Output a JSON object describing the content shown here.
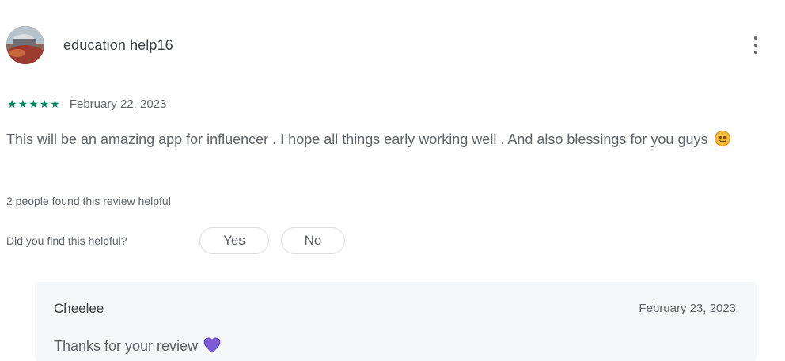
{
  "review": {
    "author": "education help16",
    "rating": 5,
    "rating_max": 5,
    "date": "February 22, 2023",
    "text": "This will be an amazing app for influencer . I hope all things early working well . And also blessings for you guys",
    "text_emoji": "smiling-face-emoji",
    "helpful_count_text": "2 people found this review helpful",
    "helpful_question": "Did you find this helpful?",
    "yes_label": "Yes",
    "no_label": "No",
    "star_color": "#01875f"
  },
  "reply": {
    "author": "Cheelee",
    "date": "February 23, 2023",
    "text": "Thanks for your review",
    "text_emoji": "purple-heart-emoji",
    "heart_color": "#7b5bd6"
  },
  "icons": {
    "more": "more-vert-icon",
    "star": "star-icon"
  }
}
